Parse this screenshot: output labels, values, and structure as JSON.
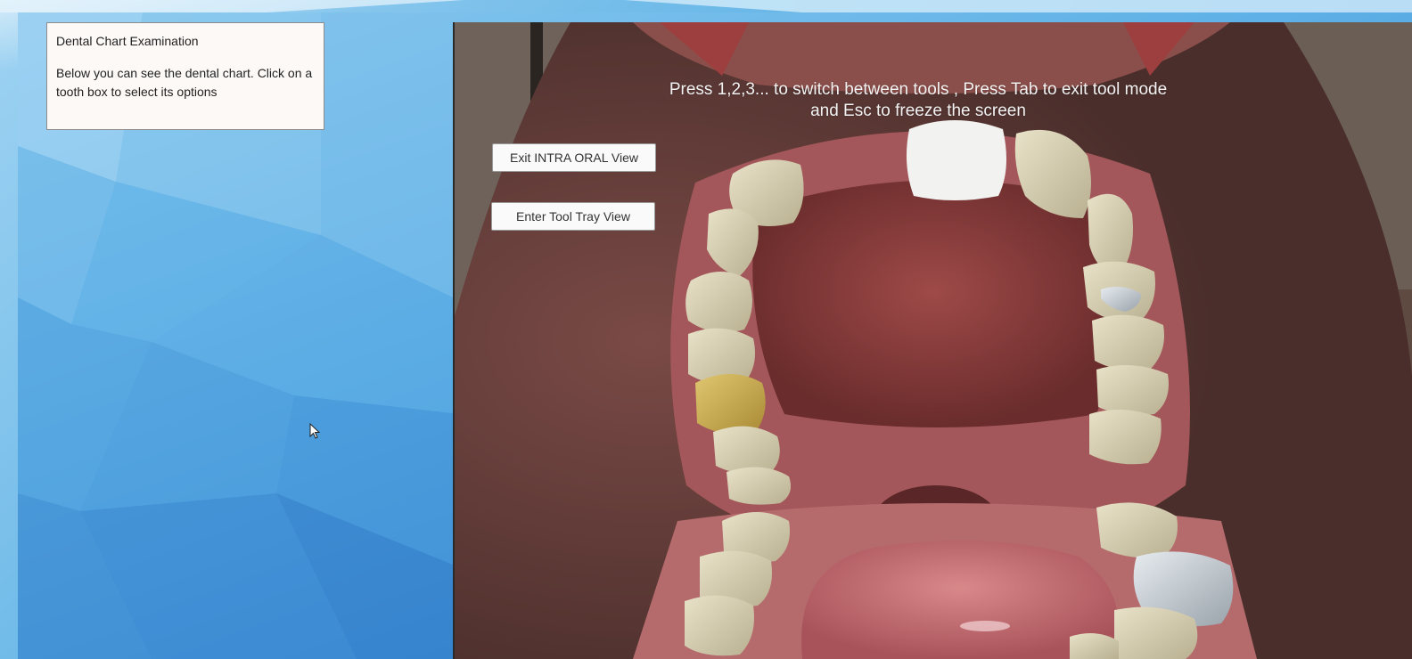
{
  "info_panel": {
    "title": "Dental Chart Examination",
    "body": "Below you can see the dental chart. Click on a tooth box to select its options"
  },
  "viewport": {
    "hint": "Press 1,2,3... to switch between tools , Press Tab to exit tool mode and Esc to freeze the screen",
    "buttons": {
      "exit_intra_oral": "Exit INTRA ORAL View",
      "enter_tool_tray": "Enter Tool Tray View"
    }
  },
  "icons": {
    "cursor": "mouse-pointer-icon"
  },
  "colors": {
    "panel_bg": "#fdf9f7",
    "desktop_blue": "#4f9fdc",
    "gum": "#b5625f",
    "palate": "#8c3a3a",
    "tooth": "#d9d2b6",
    "gold_crown": "#c9a94e",
    "metal_crown": "#b8bfc6"
  }
}
